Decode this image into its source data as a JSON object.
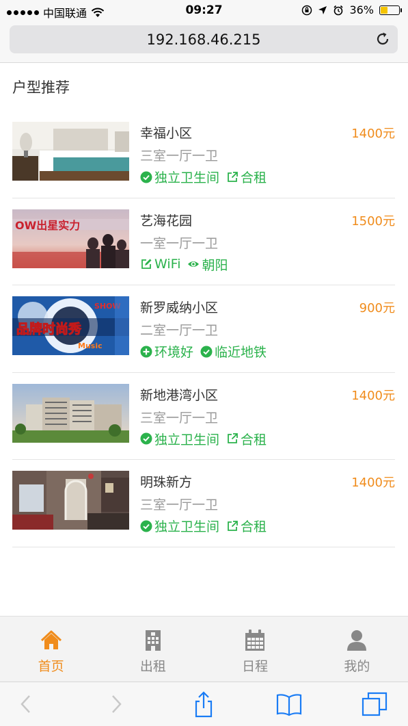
{
  "status": {
    "carrier": "中国联通",
    "time": "09:27",
    "battery": "36%"
  },
  "browser": {
    "url": "192.168.46.215"
  },
  "section_title": "户型推荐",
  "listings": [
    {
      "name": "幸福小区",
      "price": "1400元",
      "layout": "三室一厅一卫",
      "tags": [
        {
          "icon": "check-circle-icon",
          "label": "独立卫生间"
        },
        {
          "icon": "external-link-icon",
          "label": "合租"
        }
      ],
      "thumb": "bedroom"
    },
    {
      "name": "艺海花园",
      "price": "1500元",
      "layout": "一室一厅一卫",
      "tags": [
        {
          "icon": "edit-icon",
          "label": "WiFi"
        },
        {
          "icon": "eye-icon",
          "label": "朝阳"
        }
      ],
      "thumb": "banner-people"
    },
    {
      "name": "新罗威纳小区",
      "price": "900元",
      "layout": "二室一厅一卫",
      "tags": [
        {
          "icon": "plus-circle-icon",
          "label": "环境好"
        },
        {
          "icon": "check-circle-icon",
          "label": "临近地铁"
        }
      ],
      "thumb": "banner-fashion"
    },
    {
      "name": "新地港湾小区",
      "price": "1400元",
      "layout": "三室一厅一卫",
      "tags": [
        {
          "icon": "check-circle-icon",
          "label": "独立卫生间"
        },
        {
          "icon": "external-link-icon",
          "label": "合租"
        }
      ],
      "thumb": "building"
    },
    {
      "name": "明珠新方",
      "price": "1400元",
      "layout": "三室一厅一卫",
      "tags": [
        {
          "icon": "check-circle-icon",
          "label": "独立卫生间"
        },
        {
          "icon": "external-link-icon",
          "label": "合租"
        }
      ],
      "thumb": "interior"
    }
  ],
  "tabs": [
    {
      "label": "首页",
      "icon": "home-icon",
      "active": true
    },
    {
      "label": "出租",
      "icon": "building-icon",
      "active": false
    },
    {
      "label": "日程",
      "icon": "calendar-icon",
      "active": false
    },
    {
      "label": "我的",
      "icon": "user-icon",
      "active": false
    }
  ],
  "colors": {
    "accent": "#f08c1c",
    "tag_green": "#2bb24c",
    "ios_blue": "#1a7cf5"
  }
}
